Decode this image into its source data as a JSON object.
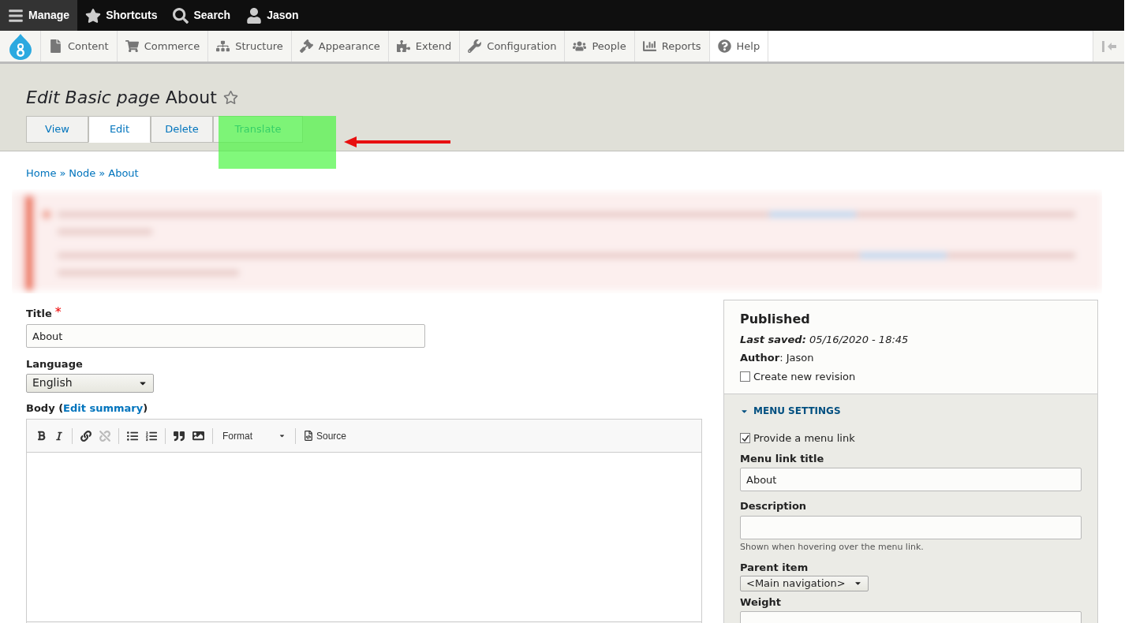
{
  "top_bar": {
    "items": [
      {
        "label": "Manage",
        "selected": true
      },
      {
        "label": "Shortcuts",
        "selected": false
      },
      {
        "label": "Search",
        "selected": false
      },
      {
        "label": "Jason",
        "selected": false
      }
    ]
  },
  "admin_menu": {
    "items": [
      {
        "label": "Content",
        "selected": false
      },
      {
        "label": "Commerce",
        "selected": false
      },
      {
        "label": "Structure",
        "selected": false
      },
      {
        "label": "Appearance",
        "selected": false
      },
      {
        "label": "Extend",
        "selected": false
      },
      {
        "label": "Configuration",
        "selected": false
      },
      {
        "label": "People",
        "selected": false
      },
      {
        "label": "Reports",
        "selected": false
      },
      {
        "label": "Help",
        "selected": true
      }
    ]
  },
  "page_title": {
    "prefix": "Edit Basic page",
    "name": "About"
  },
  "tabs": [
    {
      "label": "View",
      "selected": false
    },
    {
      "label": "Edit",
      "selected": true
    },
    {
      "label": "Delete",
      "selected": false
    },
    {
      "label": "Translate",
      "selected": false,
      "highlighted": true
    }
  ],
  "breadcrumb": [
    "Home",
    "»",
    "Node",
    "»",
    "About"
  ],
  "form": {
    "title_label": "Title",
    "required_mark": "*",
    "title_value": "About",
    "language_label": "Language",
    "language_value": "English",
    "body_label": "Body (",
    "body_link": "Edit summary",
    "body_label_end": ")",
    "editor": {
      "format": "Format",
      "source": "Source"
    }
  },
  "sidebar": {
    "status": "Published",
    "last_saved_label": "Last saved:",
    "last_saved": "05/16/2020 - 18:45",
    "author_label": "Author",
    "author": ": Jason",
    "revision": {
      "label": "Create new revision",
      "checked": false
    },
    "menu_settings": {
      "heading": "MENU SETTINGS",
      "expanded": true,
      "provide": {
        "label": "Provide a menu link",
        "checked": true
      },
      "link_title_label": "Menu link title",
      "link_title_value": "About",
      "description_label": "Description",
      "description_hint": "Shown when hovering over the menu link.",
      "parent_label": "Parent item",
      "parent_value": "<Main navigation>",
      "weight_label": "Weight"
    }
  }
}
